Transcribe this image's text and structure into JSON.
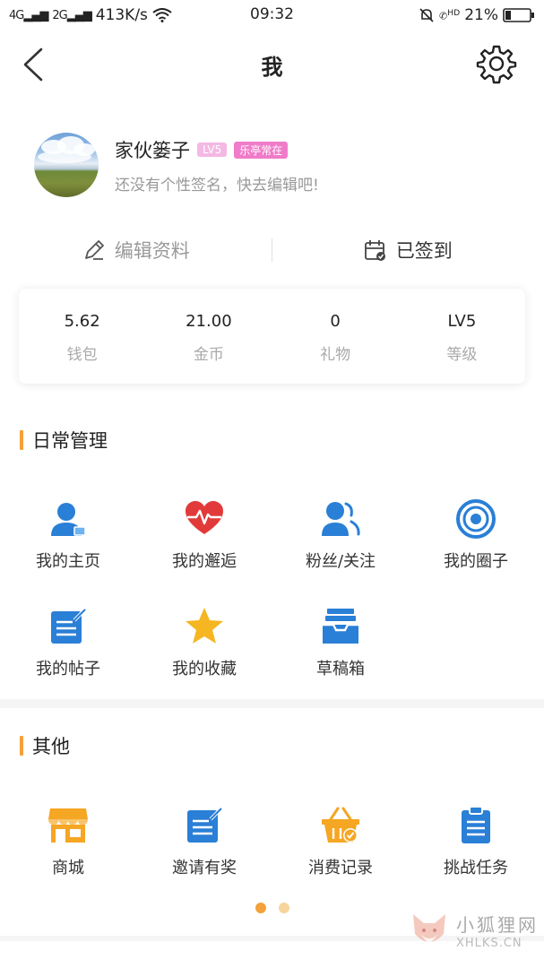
{
  "status_bar": {
    "signal_left": "4G",
    "signal_right": "2G",
    "net_speed": "413K/s",
    "time": "09:32",
    "hd": "HD",
    "battery": "21%"
  },
  "nav": {
    "title": "我"
  },
  "profile": {
    "username": "家伙篓子",
    "level_badge": "LV5",
    "tag_badge": "乐亭常在",
    "signature": "还没有个性签名，快去编辑吧!"
  },
  "actions": {
    "edit": "编辑资料",
    "sign": "已签到"
  },
  "stats": [
    {
      "value": "5.62",
      "label": "钱包"
    },
    {
      "value": "21.00",
      "label": "金币"
    },
    {
      "value": "0",
      "label": "礼物"
    },
    {
      "value": "LV5",
      "label": "等级"
    }
  ],
  "daily": {
    "title": "日常管理",
    "items": [
      {
        "label": "我的主页",
        "icon": "home-page-icon"
      },
      {
        "label": "我的邂逅",
        "icon": "heart-pulse-icon"
      },
      {
        "label": "粉丝/关注",
        "icon": "followers-icon"
      },
      {
        "label": "我的圈子",
        "icon": "circle-icon"
      },
      {
        "label": "我的帖子",
        "icon": "post-icon"
      },
      {
        "label": "我的收藏",
        "icon": "star-icon"
      },
      {
        "label": "草稿箱",
        "icon": "drafts-icon"
      }
    ]
  },
  "other": {
    "title": "其他",
    "items": [
      {
        "label": "商城",
        "icon": "shop-icon"
      },
      {
        "label": "邀请有奖",
        "icon": "invite-icon"
      },
      {
        "label": "消费记录",
        "icon": "basket-icon"
      },
      {
        "label": "挑战任务",
        "icon": "clipboard-icon"
      }
    ]
  },
  "pager": {
    "active_page": 1,
    "total_pages": 2
  },
  "watermark": {
    "cn": "小狐狸网",
    "en": "XHLKS.CN"
  },
  "colors": {
    "accent": "#f3a13a",
    "blue": "#2a7fd6",
    "red": "#e23a3a",
    "badge_lv": "#f4b8e4",
    "badge_tag": "#f07cc9"
  }
}
